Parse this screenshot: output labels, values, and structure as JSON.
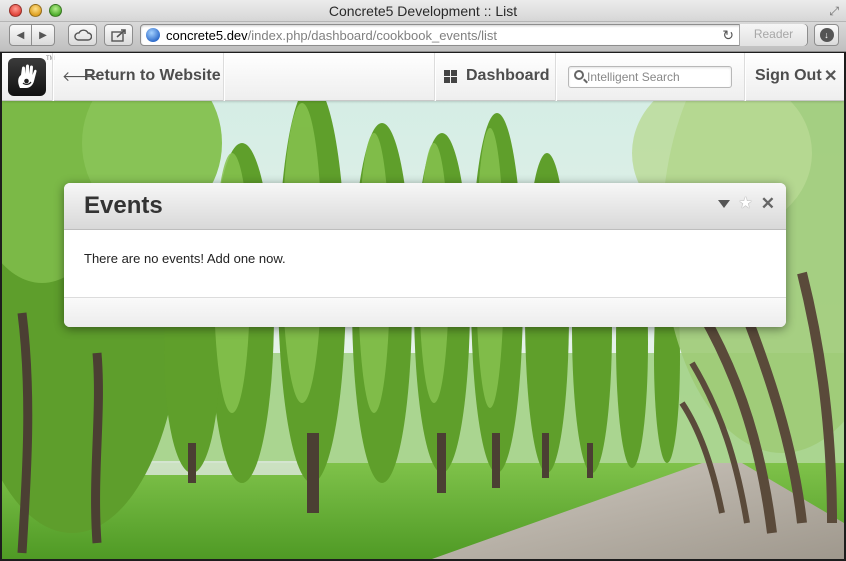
{
  "window": {
    "title": "Concrete5 Development :: List"
  },
  "browser": {
    "url_host": "concrete5.dev",
    "url_path": "/index.php/dashboard/cookbook_events/list",
    "reader_label": "Reader"
  },
  "c5toolbar": {
    "logo_tm": "TM",
    "return_label": "Return to Website",
    "dashboard_label": "Dashboard",
    "search_placeholder": "Intelligent Search",
    "signout_label": "Sign Out"
  },
  "panel": {
    "title": "Events",
    "message": "There are no events! Add one now."
  },
  "icons": {
    "back": "chevron-left-icon",
    "forward": "chevron-right-icon",
    "cloud": "cloud-icon",
    "share": "share-icon",
    "globe": "globe-icon",
    "reload": "reload-icon",
    "download": "download-icon",
    "logo": "concrete5-hand-logo",
    "return": "arrow-left-icon",
    "dashboard": "grid-icon",
    "search": "search-icon",
    "close": "close-x-icon",
    "collapse": "caret-down-icon",
    "favorite": "star-icon"
  },
  "colors": {
    "panel_header": "#e2e2e2",
    "toolbar_text": "#4d4d4d",
    "foliage": "#6fae3a",
    "sky": "#dcefe8"
  }
}
